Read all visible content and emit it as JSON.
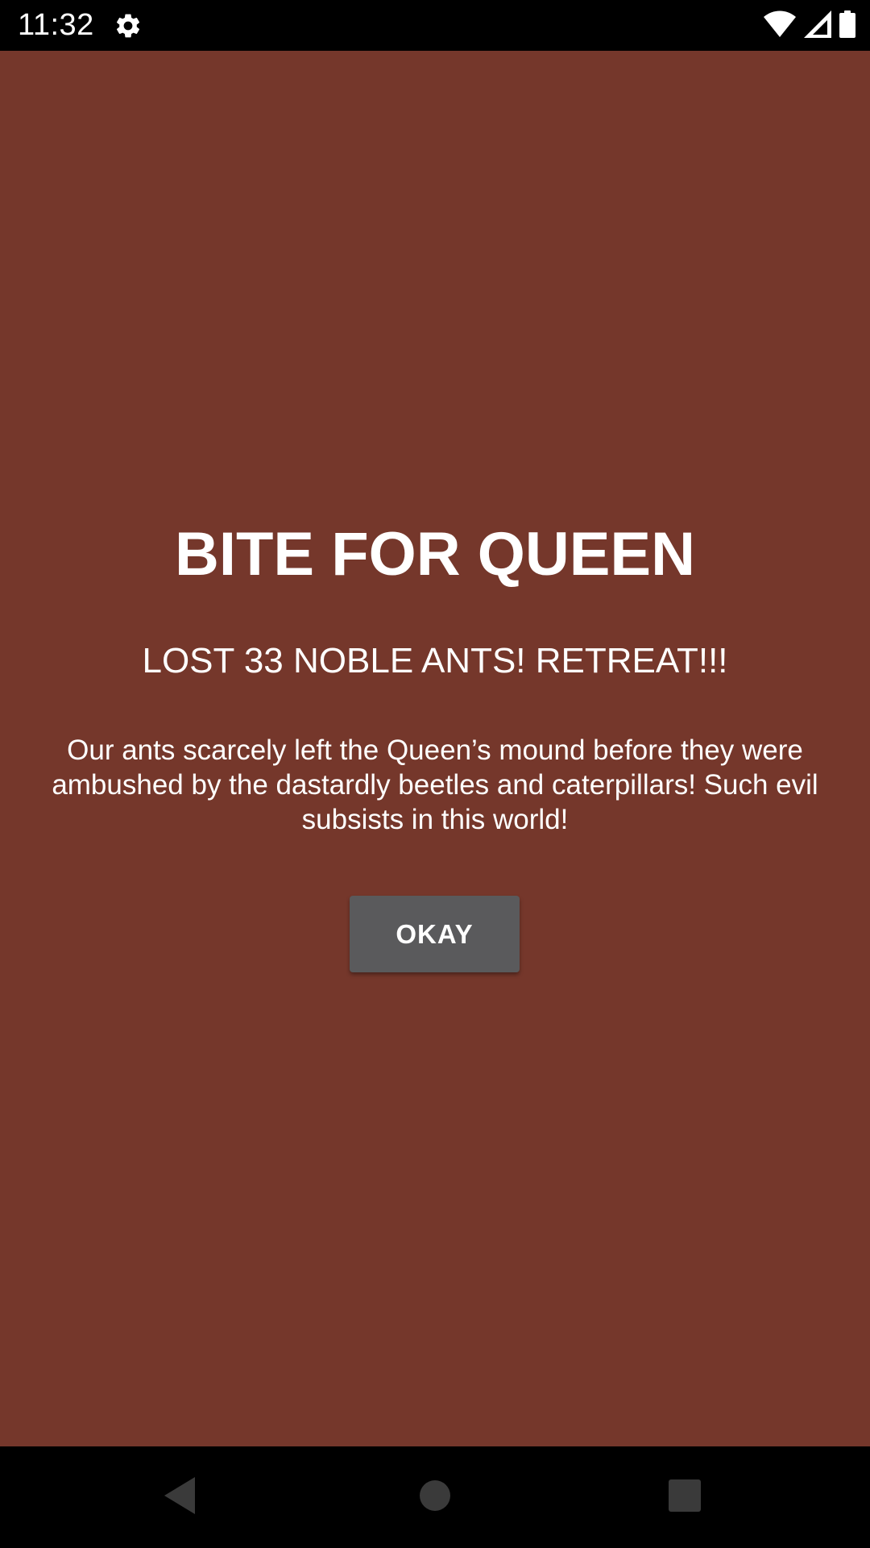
{
  "status_bar": {
    "time": "11:32",
    "icons": [
      "gear-icon",
      "wifi-icon",
      "signal-icon",
      "battery-icon"
    ]
  },
  "dialog": {
    "title": "BITE FOR QUEEN",
    "subtitle": "LOST 33 NOBLE ANTS! RETREAT!!!",
    "message": "Our ants scarcely left the Queen’s mound before they were ambushed by the dastardly beetles and caterpillars! Such evil subsists in this world!",
    "button_label": "OKAY"
  },
  "nav_bar": {
    "icons": [
      "back-icon",
      "home-icon",
      "recents-icon"
    ]
  },
  "colors": {
    "background": "#75372b",
    "button": "#5a5a5c",
    "text": "#ffffff",
    "system_bars": "#000000",
    "nav_icons": "#3a3a3a"
  }
}
